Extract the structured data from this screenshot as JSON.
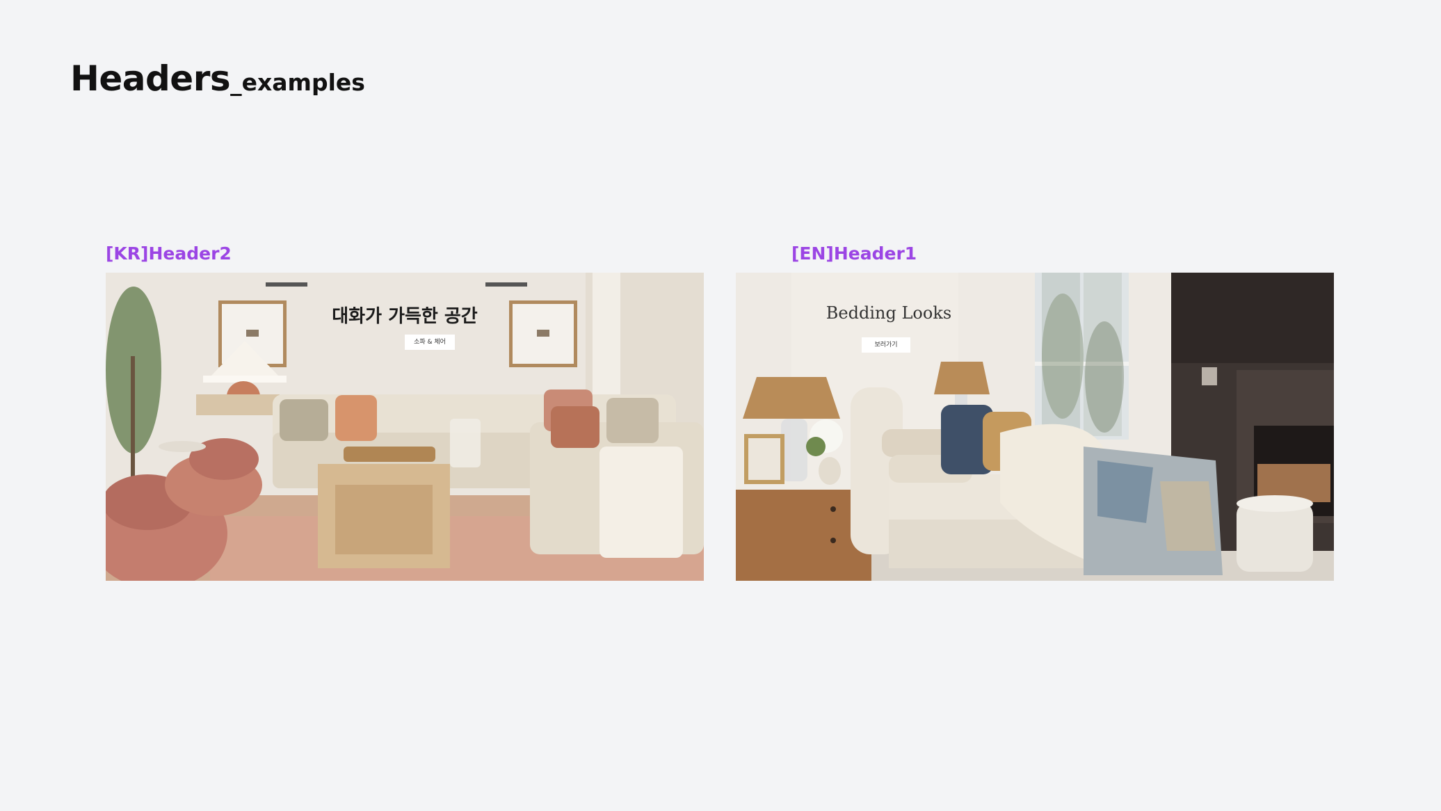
{
  "page": {
    "title_main": "Headers",
    "title_sub": "_examples"
  },
  "cards": {
    "kr": {
      "label": "[KR]Header2",
      "headline": "대화가 가득한 공간",
      "button_label": "소파 & 체어"
    },
    "en": {
      "label": "[EN]Header1",
      "headline": "Bedding Looks",
      "button_label": "보러가기"
    }
  },
  "colors": {
    "background": "#f3f4f6",
    "label_accent": "#9b45e4",
    "title_text": "#111111"
  }
}
